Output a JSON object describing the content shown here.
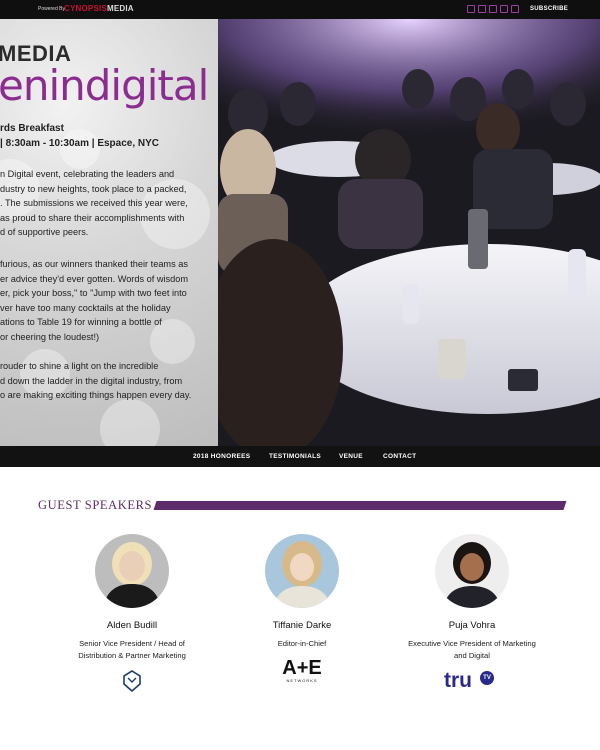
{
  "topbar": {
    "powered_by": "Powered By",
    "brand_part1": "CYNOPSIS",
    "brand_part2": "MEDIA",
    "subscribe": "SUBSCRIBE",
    "social_icons": [
      "facebook-icon",
      "twitter-icon",
      "linkedin-icon",
      "youtube-icon",
      "instagram-icon"
    ],
    "accent_color": "#9c3fa3"
  },
  "hero": {
    "logo_line1": "MEDIA",
    "logo_line2": "enindigital",
    "event_title": "rds Breakfast",
    "event_when": "| 8:30am - 10:30am | Espace, NYC",
    "paragraph1": "n Digital event, celebrating the leaders and\ndustry to new heights, took place to a packed,\n. The submissions we received this year were,\nas proud to share their accomplishments with\nd of supportive peers.",
    "paragraph2": "furious, as our winners thanked their teams as\ner advice they'd ever gotten. Words of wisdom\ner, pick your boss,\" to \"Jump with two feet into\nver have too many cocktails at the holiday\nations to Table 19 for winning a bottle of\nor cheering the loudest!)",
    "paragraph3": "rouder to shine a light on the incredible\nd down the ladder in the digital industry, from\no are making exciting things happen every day."
  },
  "nav": {
    "items": [
      "2018 HONOREES",
      "TESTIMONIALS",
      "VENUE",
      "CONTACT"
    ]
  },
  "guest_speakers": {
    "title": "GUEST SPEAKERS",
    "accent_color": "#5e2c6b",
    "speakers": [
      {
        "name": "Alden Budill",
        "role": "Senior Vice President / Head of\nDistribution & Partner Marketing",
        "logo": "pac-12-logo"
      },
      {
        "name": "Tiffanie Darke",
        "role": "Editor-in-Chief",
        "logo": "a-plus-e-networks-logo",
        "logo_text": "A+E",
        "logo_sub": "NETWORKS"
      },
      {
        "name": "Puja Vohra",
        "role": "Executive Vice President of Marketing\nand Digital",
        "logo": "trutv-logo",
        "logo_text": "tru",
        "logo_badge": "TV"
      }
    ]
  }
}
